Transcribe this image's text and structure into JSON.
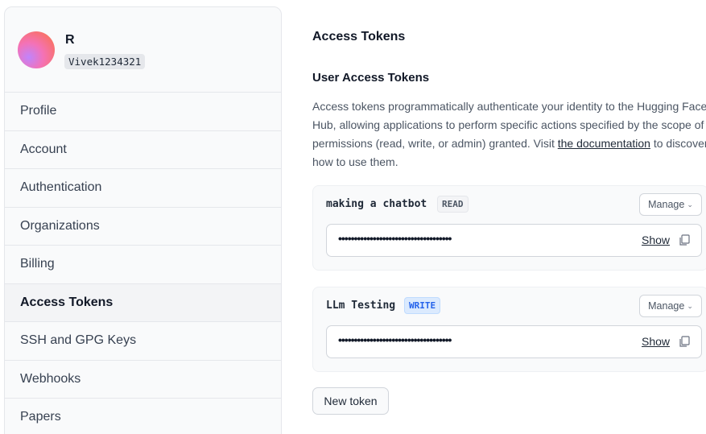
{
  "user": {
    "name": "R",
    "handle": "Vivek1234321"
  },
  "sidebar": {
    "items": [
      {
        "label": "Profile",
        "active": false
      },
      {
        "label": "Account",
        "active": false
      },
      {
        "label": "Authentication",
        "active": false
      },
      {
        "label": "Organizations",
        "active": false
      },
      {
        "label": "Billing",
        "active": false
      },
      {
        "label": "Access Tokens",
        "active": true
      },
      {
        "label": "SSH and GPG Keys",
        "active": false
      },
      {
        "label": "Webhooks",
        "active": false
      },
      {
        "label": "Papers",
        "active": false
      }
    ]
  },
  "main": {
    "title": "Access Tokens",
    "section_title": "User Access Tokens",
    "description_prefix": "Access tokens programmatically authenticate your identity to the Hugging Face Hub, allowing applications to perform specific actions specified by the scope of permissions (read, write, or admin) granted. Visit ",
    "description_link": "the documentation",
    "description_suffix": " to discover how to use them.",
    "tokens": [
      {
        "name": "making a chatbot",
        "role": "READ",
        "masked": "••••••••••••••••••••••••••••••••••••",
        "manage_label": "Manage",
        "show_label": "Show"
      },
      {
        "name": "LLm Testing",
        "role": "WRITE",
        "masked": "••••••••••••••••••••••••••••••••••••",
        "manage_label": "Manage",
        "show_label": "Show"
      }
    ],
    "new_token_label": "New token"
  },
  "colors": {
    "accent_write": "#2563eb",
    "active_nav_bg": "#f3f4f6"
  },
  "icons": {
    "manage_chevron": "chevron-down-icon",
    "copy": "copy-icon"
  }
}
